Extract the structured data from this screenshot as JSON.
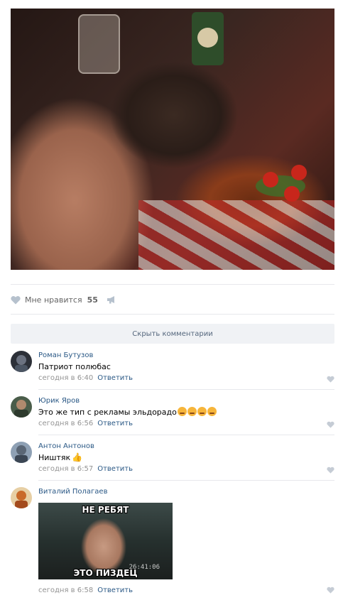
{
  "post": {
    "likes_label": "Мне нравится",
    "likes_count": "55"
  },
  "comments_toggle": "Скрыть комментарии",
  "comments": [
    {
      "author": "Роман Бутузов",
      "text": "Патриот полюбас",
      "time": "сегодня в 6:40",
      "reply": "Ответить"
    },
    {
      "author": "Юрик Яров",
      "text": "Это же тип с рекламы эльдорадо",
      "time": "сегодня в 6:56",
      "reply": "Ответить"
    },
    {
      "author": "Антон Антонов",
      "text": "Ништяк",
      "time": "сегодня в 6:57",
      "reply": "Ответить"
    },
    {
      "author": "Виталий Полагаев",
      "time": "сегодня в 6:58",
      "reply": "Ответить",
      "meme": {
        "top": "НЕ РЕБЯТ",
        "bottom": "ЭТО ПИЗДЕЦ",
        "stamp": "26:41:06"
      }
    }
  ],
  "colors": {
    "link": "#2a5885",
    "meta": "#939393",
    "divider": "#e7e8ec"
  },
  "icons": {
    "like": "heart-icon",
    "share": "megaphone-icon",
    "emoji": "angry-face-emoji",
    "thumb": "thumbs-up-emoji"
  }
}
